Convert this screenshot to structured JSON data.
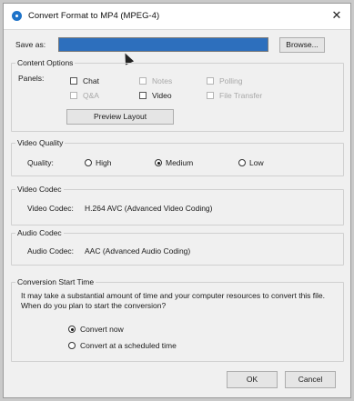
{
  "window": {
    "title": "Convert Format to MP4 (MPEG-4)",
    "close": "✕"
  },
  "save_as": {
    "label": "Save as:",
    "value": "",
    "browse": "Browse..."
  },
  "content_options": {
    "title": "Content Options",
    "panels_label": "Panels:",
    "items": [
      {
        "label": "Chat",
        "enabled": true
      },
      {
        "label": "Notes",
        "enabled": false
      },
      {
        "label": "Polling",
        "enabled": false
      },
      {
        "label": "Q&A",
        "enabled": false
      },
      {
        "label": "Video",
        "enabled": true
      },
      {
        "label": "File Transfer",
        "enabled": false
      }
    ],
    "preview_button": "Preview Layout"
  },
  "video_quality": {
    "title": "Video Quality",
    "label": "Quality:",
    "options": [
      "High",
      "Medium",
      "Low"
    ],
    "selected": "Medium"
  },
  "video_codec": {
    "title": "Video Codec",
    "label": "Video Codec:",
    "value": "H.264 AVC (Advanced Video Coding)"
  },
  "audio_codec": {
    "title": "Audio Codec",
    "label": "Audio Codec:",
    "value": "AAC (Advanced Audio Coding)"
  },
  "conversion": {
    "title": "Conversion Start Time",
    "description_line1": "It may take a substantial amount of time and your computer resources to convert this file.",
    "description_line2": "When do you plan to start the conversion?",
    "options": [
      "Convert now",
      "Convert at a scheduled time"
    ],
    "selected": "Convert now"
  },
  "footer": {
    "ok": "OK",
    "cancel": "Cancel"
  }
}
